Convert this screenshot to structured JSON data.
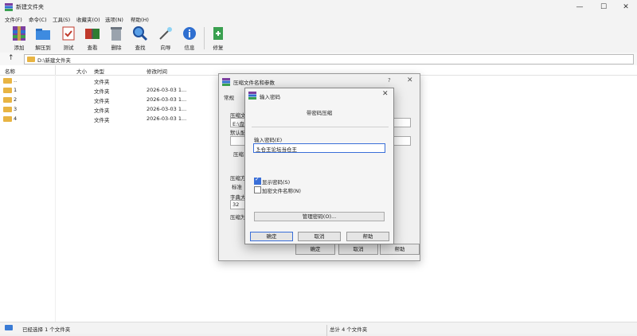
{
  "window": {
    "title": "新建文件夹"
  },
  "menu": [
    "文件(F)",
    "命令(C)",
    "工具(S)",
    "收藏夹(O)",
    "选项(N)",
    "帮助(H)"
  ],
  "toolbar": [
    {
      "label": "添加",
      "icon": "add-archive-icon"
    },
    {
      "label": "解压到",
      "icon": "extract-folder-icon"
    },
    {
      "label": "测试",
      "icon": "test-icon"
    },
    {
      "label": "查看",
      "icon": "view-book-icon"
    },
    {
      "label": "删除",
      "icon": "trash-icon"
    },
    {
      "label": "查找",
      "icon": "magnifier-icon"
    },
    {
      "label": "向导",
      "icon": "wizard-wand-icon"
    },
    {
      "label": "信息",
      "icon": "info-icon"
    },
    {
      "label": "修复",
      "icon": "repair-icon"
    }
  ],
  "address": {
    "path": "D:\\新建文件夹"
  },
  "columns": {
    "name": "名称",
    "size": "大小",
    "type": "类型",
    "modified": "修改时间"
  },
  "files": [
    {
      "name": "..",
      "type": "文件夹",
      "modified": ""
    },
    {
      "name": "1",
      "type": "文件夹",
      "modified": "2026-03-03 1..."
    },
    {
      "name": "2",
      "type": "文件夹",
      "modified": "2026-03-03 1..."
    },
    {
      "name": "3",
      "type": "文件夹",
      "modified": "2026-03-03 1..."
    },
    {
      "name": "4",
      "type": "文件夹",
      "modified": "2026-03-03 1..."
    }
  ],
  "status": {
    "left": "已经选择 1 个文件夹",
    "right": "总计 4 个文件夹"
  },
  "archive_dialog": {
    "title": "压缩文件名和参数",
    "help_glyph": "?",
    "tab": "常规",
    "labels": [
      "压缩文",
      "E:\\盘\\",
      "默认配",
      "压缩",
      "压缩方",
      "标准",
      "字典大",
      "32",
      "压缩为"
    ],
    "ok": "确定",
    "cancel": "取消",
    "help": "帮助"
  },
  "password_dialog": {
    "title": "输入密码",
    "subtitle": "带密码压缩",
    "pwd_label": "输入密码(E)",
    "pwd_value": "上仓王论坛当仓王",
    "show_pwd": "显示密码(S)",
    "show_pwd_checked": true,
    "encrypt_names": "加密文件名称(N)",
    "encrypt_names_checked": false,
    "manage": "管理密码(O)...",
    "ok": "确定",
    "cancel": "取消",
    "help": "帮助"
  }
}
